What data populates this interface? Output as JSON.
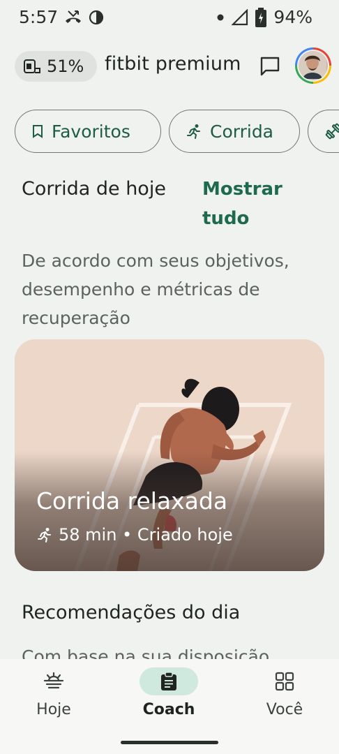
{
  "status_bar": {
    "time": "5:57",
    "battery": "94%",
    "icons": [
      "missed-call-icon",
      "vpn-icon",
      "dot-icon",
      "signal-icon",
      "battery-icon"
    ]
  },
  "header": {
    "device_battery": "51%",
    "device_icon": "watch-battery-icon",
    "title": "fitbit premium",
    "inbox_icon": "message-icon",
    "avatar_icon": "profile-avatar"
  },
  "chips": [
    {
      "label": "Favoritos",
      "icon": "bookmark-icon"
    },
    {
      "label": "Corrida",
      "icon": "run-icon"
    },
    {
      "label": "",
      "icon": "dumbbell-icon"
    }
  ],
  "today_run": {
    "title": "Corrida de hoje",
    "show_all": "Mostrar tudo",
    "description": "De acordo com seus objetivos, desempenho e métricas de recuperação"
  },
  "card": {
    "title": "Corrida relaxada",
    "meta": "58 min • Criado hoje",
    "icon": "run-icon"
  },
  "recommendations": {
    "title": "Recomendações do dia",
    "description": "Com base na sua disposição"
  },
  "nav": {
    "items": [
      {
        "label": "Hoje",
        "icon": "today-icon",
        "active": false
      },
      {
        "label": "Coach",
        "icon": "clipboard-icon",
        "active": true
      },
      {
        "label": "Você",
        "icon": "grid-icon",
        "active": false
      }
    ]
  },
  "colors": {
    "accent": "#1d6a4f",
    "chip_text": "#1d5c45",
    "nav_active_bg": "#cfe9de",
    "card_bg": "#ecd7c9"
  }
}
